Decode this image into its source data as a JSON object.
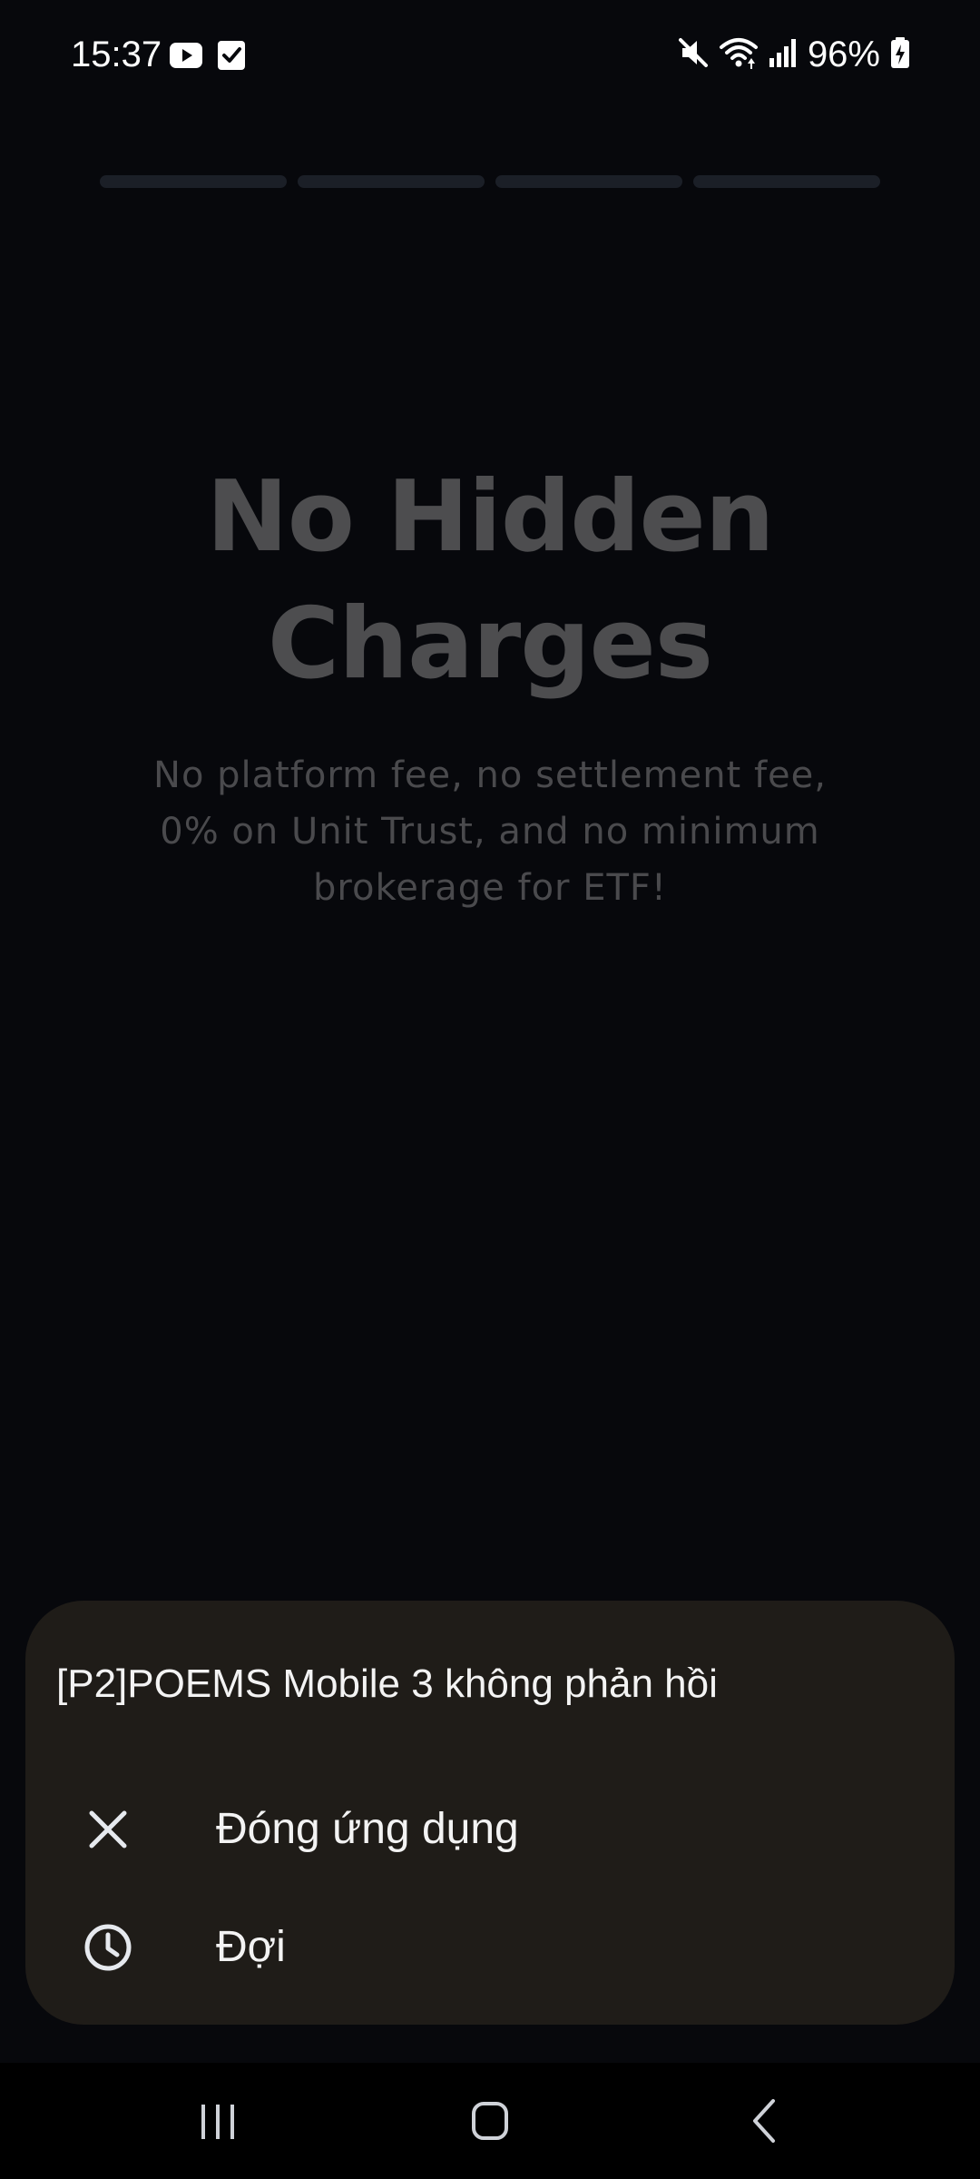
{
  "status_bar": {
    "time": "15:37",
    "notification_icons": [
      "youtube-icon",
      "checkbox-icon"
    ],
    "system_icons": [
      "mute-icon",
      "wifi-icon",
      "signal-icon"
    ],
    "battery_percent": "96%"
  },
  "onboarding": {
    "progress_segments": 4,
    "headline": "No Hidden\nCharges",
    "subtext": "No platform fee, no settlement fee, 0% on Unit Trust, and no minimum brokerage for ETF!"
  },
  "dialog": {
    "title": "[P2]POEMS Mobile 3 không phản hồi",
    "options": [
      {
        "icon": "close-icon",
        "label": "Đóng ứng dụng"
      },
      {
        "icon": "clock-icon",
        "label": "Đợi"
      }
    ]
  },
  "nav_bar": {
    "buttons": [
      "recent-apps-icon",
      "home-icon",
      "back-icon"
    ]
  },
  "colors": {
    "background": "#07080c",
    "dialog_background": "#1f1c18",
    "dimmed_text": "#4d4d4f",
    "progress_track": "#1b1f27"
  }
}
